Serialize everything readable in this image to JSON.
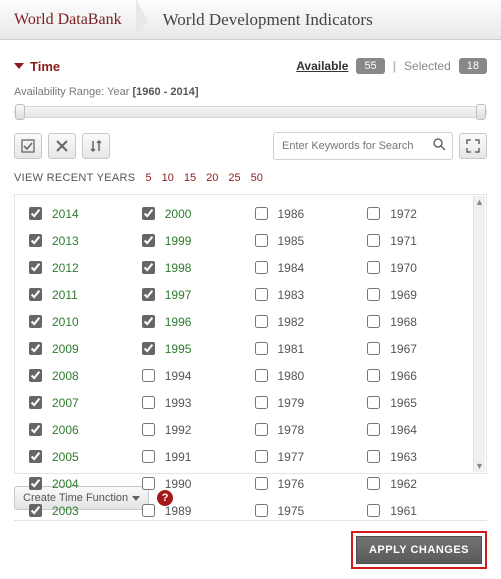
{
  "header": {
    "brand": "World DataBank",
    "subtitle": "World Development Indicators"
  },
  "section": {
    "title": "Time",
    "available_label": "Available",
    "available_count": "55",
    "selected_label": "Selected",
    "selected_count": "18",
    "range_label": "Availability Range: Year",
    "range_value": "[1960 - 2014]"
  },
  "toolbar": {
    "select_all_icon": "select-all-icon",
    "clear_icon": "clear-icon",
    "sort_icon": "sort-icon",
    "search_placeholder": "Enter Keywords for Search",
    "expand_icon": "expand-icon"
  },
  "recent": {
    "label": "VIEW RECENT YEARS",
    "options": [
      "5",
      "10",
      "15",
      "20",
      "25",
      "50"
    ]
  },
  "years": {
    "columns": [
      [
        {
          "y": "2014",
          "s": true
        },
        {
          "y": "2013",
          "s": true
        },
        {
          "y": "2012",
          "s": true
        },
        {
          "y": "2011",
          "s": true
        },
        {
          "y": "2010",
          "s": true
        },
        {
          "y": "2009",
          "s": true
        },
        {
          "y": "2008",
          "s": true
        },
        {
          "y": "2007",
          "s": true
        },
        {
          "y": "2006",
          "s": true
        },
        {
          "y": "2005",
          "s": true
        },
        {
          "y": "2004",
          "s": true
        },
        {
          "y": "2003",
          "s": true
        }
      ],
      [
        {
          "y": "2000",
          "s": true
        },
        {
          "y": "1999",
          "s": true
        },
        {
          "y": "1998",
          "s": true
        },
        {
          "y": "1997",
          "s": true
        },
        {
          "y": "1996",
          "s": true
        },
        {
          "y": "1995",
          "s": true
        },
        {
          "y": "1994",
          "s": false
        },
        {
          "y": "1993",
          "s": false
        },
        {
          "y": "1992",
          "s": false
        },
        {
          "y": "1991",
          "s": false
        },
        {
          "y": "1990",
          "s": false
        },
        {
          "y": "1989",
          "s": false
        }
      ],
      [
        {
          "y": "1986",
          "s": false
        },
        {
          "y": "1985",
          "s": false
        },
        {
          "y": "1984",
          "s": false
        },
        {
          "y": "1983",
          "s": false
        },
        {
          "y": "1982",
          "s": false
        },
        {
          "y": "1981",
          "s": false
        },
        {
          "y": "1980",
          "s": false
        },
        {
          "y": "1979",
          "s": false
        },
        {
          "y": "1978",
          "s": false
        },
        {
          "y": "1977",
          "s": false
        },
        {
          "y": "1976",
          "s": false
        },
        {
          "y": "1975",
          "s": false
        }
      ],
      [
        {
          "y": "1972",
          "s": false
        },
        {
          "y": "1971",
          "s": false
        },
        {
          "y": "1970",
          "s": false
        },
        {
          "y": "1969",
          "s": false
        },
        {
          "y": "1968",
          "s": false
        },
        {
          "y": "1967",
          "s": false
        },
        {
          "y": "1966",
          "s": false
        },
        {
          "y": "1965",
          "s": false
        },
        {
          "y": "1964",
          "s": false
        },
        {
          "y": "1963",
          "s": false
        },
        {
          "y": "1962",
          "s": false
        },
        {
          "y": "1961",
          "s": false
        }
      ]
    ]
  },
  "footer": {
    "create_time_fn": "Create Time Function",
    "apply": "APPLY CHANGES"
  }
}
